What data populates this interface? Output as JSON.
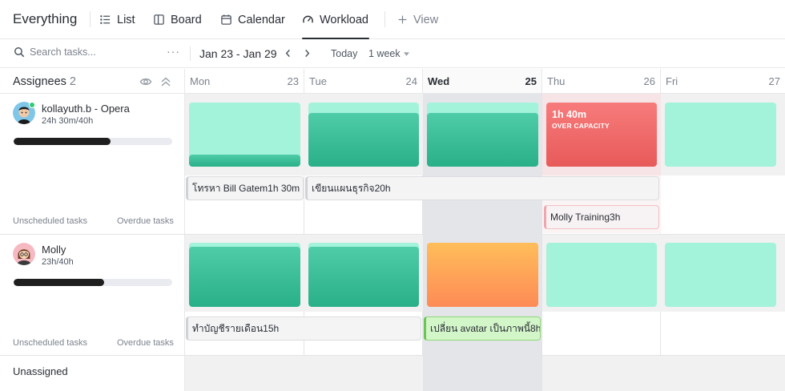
{
  "app": {
    "title": "Everything"
  },
  "views": [
    {
      "label": "List",
      "icon": "list-icon"
    },
    {
      "label": "Board",
      "icon": "board-icon"
    },
    {
      "label": "Calendar",
      "icon": "calendar-icon"
    },
    {
      "label": "Workload",
      "icon": "workload-gauge-icon",
      "active": true
    },
    {
      "label": "View",
      "icon": "plus-icon"
    }
  ],
  "toolbar": {
    "search_placeholder": "Search tasks...",
    "more": "···",
    "date_range": "Jan 23 - Jan 29",
    "today": "Today",
    "period": "1 week"
  },
  "assignees": {
    "label": "Assignees",
    "count": "2"
  },
  "days": [
    {
      "name": "Mon",
      "num": "23"
    },
    {
      "name": "Tue",
      "num": "24"
    },
    {
      "name": "Wed",
      "num": "25",
      "today": true
    },
    {
      "name": "Thu",
      "num": "26"
    },
    {
      "name": "Fri",
      "num": "27"
    }
  ],
  "people": [
    {
      "name": "kollayuth.b - Opera",
      "hours": "24h 30m/40h",
      "progress": 0.61,
      "unscheduled": "Unscheduled tasks",
      "overdue": "Overdue tasks",
      "capacity_alert": {
        "value": "1h 40m",
        "label": "OVER CAPACITY"
      },
      "tasks": [
        {
          "title": "โทรหา Bill Gatem",
          "duration": "1h 30m"
        },
        {
          "title": "เขียนแผนธุรกิจ",
          "duration": "20h"
        },
        {
          "title": "Molly Training",
          "duration": "3h"
        }
      ]
    },
    {
      "name": "Molly",
      "hours": "23h/40h",
      "progress": 0.57,
      "unscheduled": "Unscheduled tasks",
      "overdue": "Overdue tasks",
      "tasks": [
        {
          "title": "ทำบัญชีรายเดือน",
          "duration": "15h"
        },
        {
          "title": "เปลี่ยน avatar เป็นภาพนี้",
          "duration": "8h"
        }
      ]
    }
  ],
  "unassigned": {
    "label": "Unassigned"
  },
  "colors": {
    "capacity_free": "#a3f2da",
    "capacity_used": "#29b088",
    "over_capacity": "#e85a5a",
    "near_capacity": "#fd8b56",
    "today_column": "#e4e5e8"
  }
}
